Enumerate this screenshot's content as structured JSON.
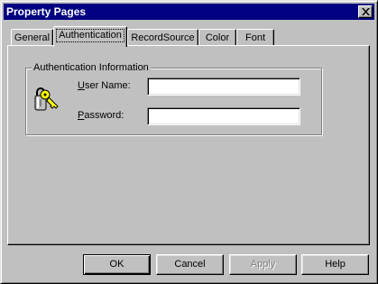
{
  "window": {
    "title": "Property Pages"
  },
  "tabs": [
    {
      "label": "General",
      "active": false
    },
    {
      "label": "Authentication",
      "active": true
    },
    {
      "label": "RecordSource",
      "active": false
    },
    {
      "label": "Color",
      "active": false
    },
    {
      "label": "Font",
      "active": false
    }
  ],
  "group": {
    "label": "Authentication Information",
    "icon": "key-icon",
    "username": {
      "label_prefix": "U",
      "label_rest": "ser Name:",
      "value": ""
    },
    "password": {
      "label_prefix": "P",
      "label_rest": "assword:",
      "value": ""
    }
  },
  "buttons": {
    "ok": "OK",
    "cancel": "Cancel",
    "apply": "Apply",
    "help": "Help"
  }
}
